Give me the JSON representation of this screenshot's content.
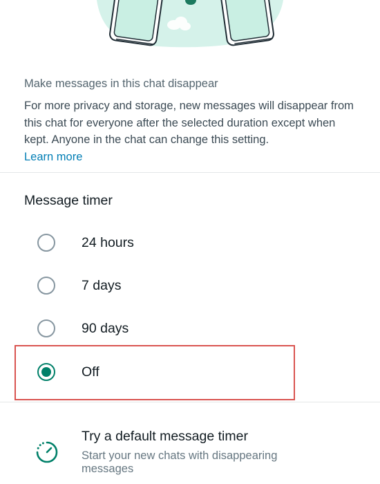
{
  "intro": {
    "title": "Make messages in this chat disappear",
    "body": "For more privacy and storage, new messages will disappear from this chat for everyone after the selected duration except when kept. Anyone in the chat can change this setting.",
    "learn_more": "Learn more"
  },
  "timer": {
    "title": "Message timer",
    "options": [
      {
        "label": "24 hours",
        "selected": false
      },
      {
        "label": "7 days",
        "selected": false
      },
      {
        "label": "90 days",
        "selected": false
      },
      {
        "label": "Off",
        "selected": true
      }
    ]
  },
  "default_timer": {
    "title": "Try a default message timer",
    "subtitle": "Start your new chats with disappearing messages",
    "icon": "timer-icon"
  },
  "colors": {
    "accent": "#008069",
    "radio_off": "#8696a0",
    "link": "#027eb5",
    "highlight": "#d9534f"
  }
}
